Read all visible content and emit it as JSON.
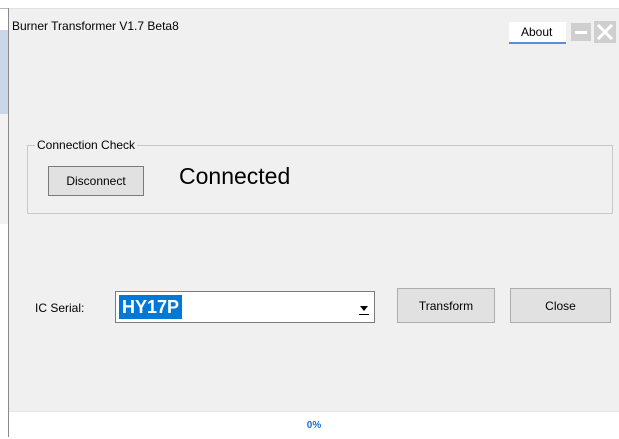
{
  "window": {
    "title": "Burner Transformer V1.7 Beta8"
  },
  "header": {
    "about_label": "About"
  },
  "connection": {
    "group_label": "Connection Check",
    "disconnect_label": "Disconnect",
    "status_text": "Connected"
  },
  "ic": {
    "label": "IC Serial:",
    "selected_value": "HY17P"
  },
  "actions": {
    "transform_label": "Transform",
    "close_label": "Close"
  },
  "progress": {
    "text": "0%",
    "value": 0
  },
  "colors": {
    "selection": "#0078d7",
    "progress_text": "#1e6fd0",
    "window_bg": "#f0f0f0"
  },
  "icons": [
    "minimize-icon",
    "close-icon",
    "dropdown-arrow-icon"
  ]
}
